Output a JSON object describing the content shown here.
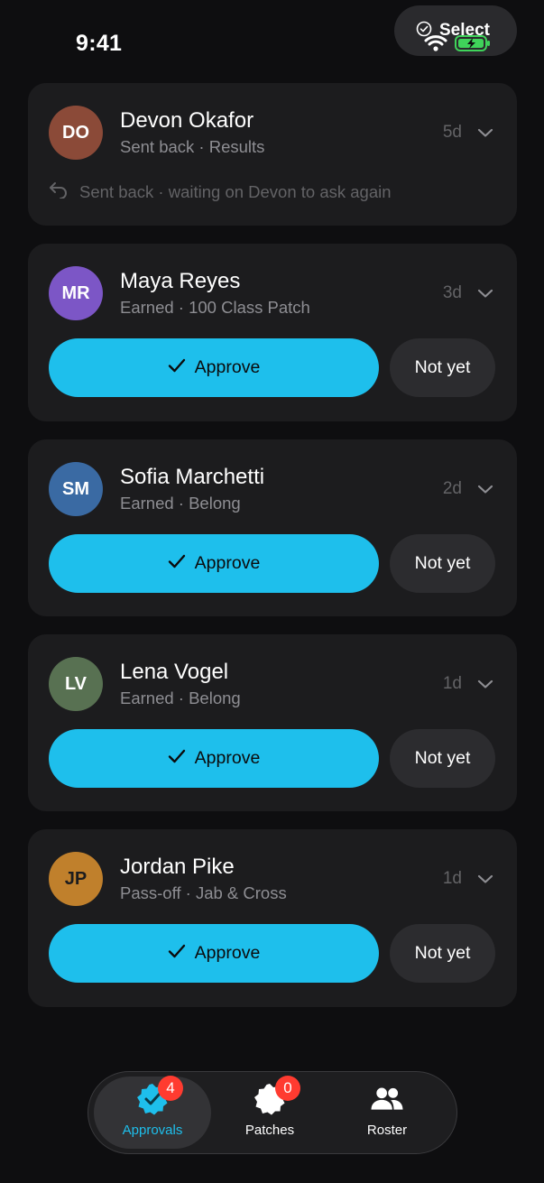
{
  "status_bar": {
    "time": "9:41"
  },
  "header": {
    "select_label": "Select"
  },
  "cards": [
    {
      "initials": "DO",
      "name": "Devon Okafor",
      "subtitle": "Sent back · Results",
      "age": "5d",
      "avatar_color": "#8b4a38",
      "note": "Sent back · waiting on Devon to ask again"
    },
    {
      "initials": "MR",
      "name": "Maya Reyes",
      "subtitle": "Earned · 100 Class Patch",
      "age": "3d",
      "avatar_color": "#7c56c6",
      "approve_label": "Approve",
      "notyet_label": "Not yet"
    },
    {
      "initials": "SM",
      "name": "Sofia Marchetti",
      "subtitle": "Earned · Belong",
      "age": "2d",
      "avatar_color": "#3a6aa3",
      "approve_label": "Approve",
      "notyet_label": "Not yet"
    },
    {
      "initials": "LV",
      "name": "Lena Vogel",
      "subtitle": "Earned · Belong",
      "age": "1d",
      "avatar_color": "#587152",
      "approve_label": "Approve",
      "notyet_label": "Not yet"
    },
    {
      "initials": "JP",
      "name": "Jordan Pike",
      "subtitle": "Pass-off · Jab & Cross",
      "age": "1d",
      "avatar_color": "#c0802c",
      "approve_label": "Approve",
      "notyet_label": "Not yet"
    }
  ],
  "tabs": [
    {
      "label": "Approvals",
      "badge": "4",
      "icon": "check-badge-icon",
      "active": true
    },
    {
      "label": "Patches",
      "badge": "0",
      "icon": "patch-icon",
      "active": false
    },
    {
      "label": "Roster",
      "icon": "people-icon",
      "active": false
    }
  ],
  "colors": {
    "accent": "#1ebfec",
    "badge": "#ff3b30",
    "card": "#1c1c1e",
    "background": "#0e0e10"
  }
}
